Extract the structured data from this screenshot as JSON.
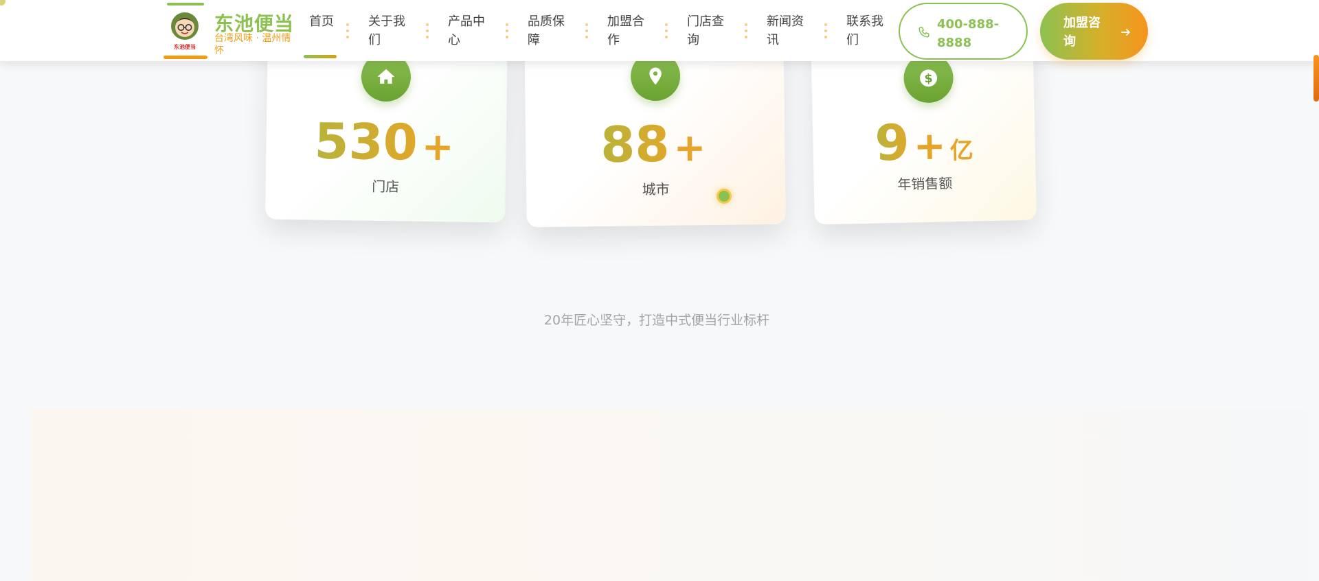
{
  "header": {
    "logo": {
      "title": "东池便当",
      "subtitle": "台湾风味 · 温州情怀",
      "badge_text": "东池便当"
    },
    "nav": [
      {
        "label": "首页",
        "active": true
      },
      {
        "label": "关于我们",
        "active": false
      },
      {
        "label": "产品中心",
        "active": false
      },
      {
        "label": "品质保障",
        "active": false
      },
      {
        "label": "加盟合作",
        "active": false
      },
      {
        "label": "门店查询",
        "active": false
      },
      {
        "label": "新闻资讯",
        "active": false
      },
      {
        "label": "联系我们",
        "active": false
      }
    ],
    "phone": {
      "label": "400-888-8888",
      "icon": "phone-icon"
    },
    "join_button": {
      "label": "加盟咨询",
      "icon": "arrow-right-icon"
    }
  },
  "stats": [
    {
      "icon": "home-icon",
      "number": "530",
      "suffix": "+",
      "unit": "",
      "label": "门店"
    },
    {
      "icon": "map-pin-icon",
      "number": "88",
      "suffix": "+",
      "unit": "",
      "label": "城市"
    },
    {
      "icon": "dollar-icon",
      "number": "9",
      "suffix": "+",
      "unit": "亿",
      "label": "年销售额"
    }
  ],
  "tagline": "20年匠心坚守，打造中式便当行业标杆",
  "colors": {
    "brand_green": "#8cc152",
    "brand_orange": "#f39c12",
    "number_gold": "#e6a52a",
    "page_bg": "#f7f8fa"
  }
}
